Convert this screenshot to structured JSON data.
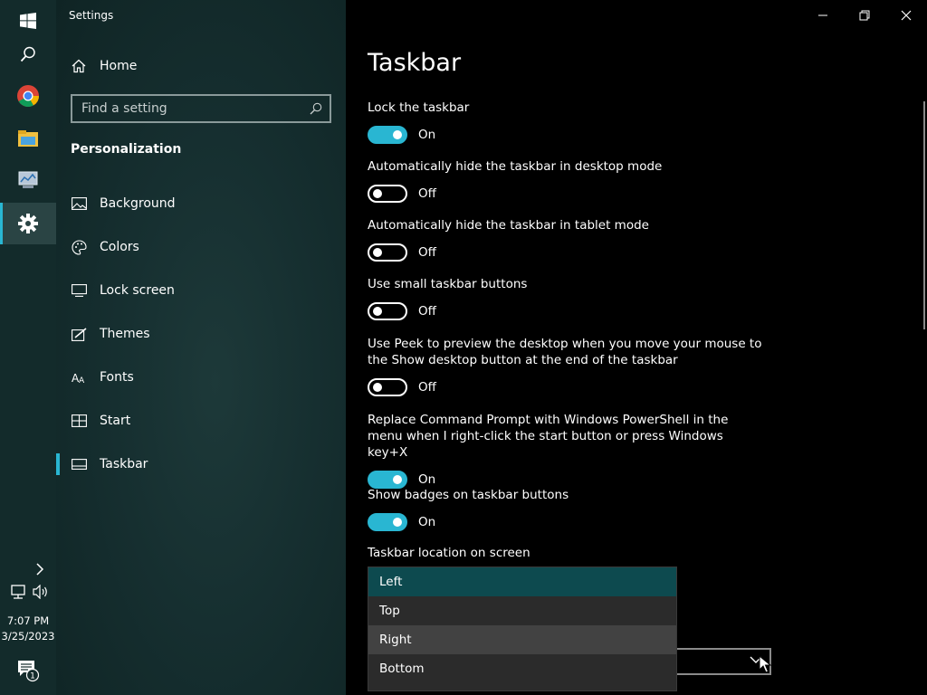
{
  "app": {
    "title": "Settings"
  },
  "taskbar": {
    "time": "7:07 PM",
    "date": "3/25/2023",
    "notification_count": "1"
  },
  "sidebar": {
    "home_label": "Home",
    "search_placeholder": "Find a setting",
    "section_title": "Personalization",
    "items": [
      {
        "label": "Background",
        "icon": "picture-icon"
      },
      {
        "label": "Colors",
        "icon": "palette-icon"
      },
      {
        "label": "Lock screen",
        "icon": "lock-screen-icon"
      },
      {
        "label": "Themes",
        "icon": "themes-icon"
      },
      {
        "label": "Fonts",
        "icon": "fonts-icon"
      },
      {
        "label": "Start",
        "icon": "start-icon"
      },
      {
        "label": "Taskbar",
        "icon": "taskbar-icon",
        "selected": true
      }
    ]
  },
  "main": {
    "title": "Taskbar",
    "settings": [
      {
        "label": "Lock the taskbar",
        "state": "On"
      },
      {
        "label": "Automatically hide the taskbar in desktop mode",
        "state": "Off"
      },
      {
        "label": "Automatically hide the taskbar in tablet mode",
        "state": "Off"
      },
      {
        "label": "Use small taskbar buttons",
        "state": "Off"
      },
      {
        "label": "Use Peek to preview the desktop when you move your mouse to the Show desktop button at the end of the taskbar",
        "state": "Off"
      },
      {
        "label": "Replace Command Prompt with Windows PowerShell in the menu when I right-click the start button or press Windows key+X",
        "state": "On"
      },
      {
        "label": "Show badges on taskbar buttons",
        "state": "On"
      }
    ],
    "location_label": "Taskbar location on screen",
    "location_options": [
      "Left",
      "Top",
      "Right",
      "Bottom"
    ],
    "location_selected": "Left",
    "location_hovered": "Right"
  },
  "colors": {
    "accent": "#29b6d2",
    "sidebar_bg": "#162f30",
    "selected_option": "#0d4a4f"
  }
}
